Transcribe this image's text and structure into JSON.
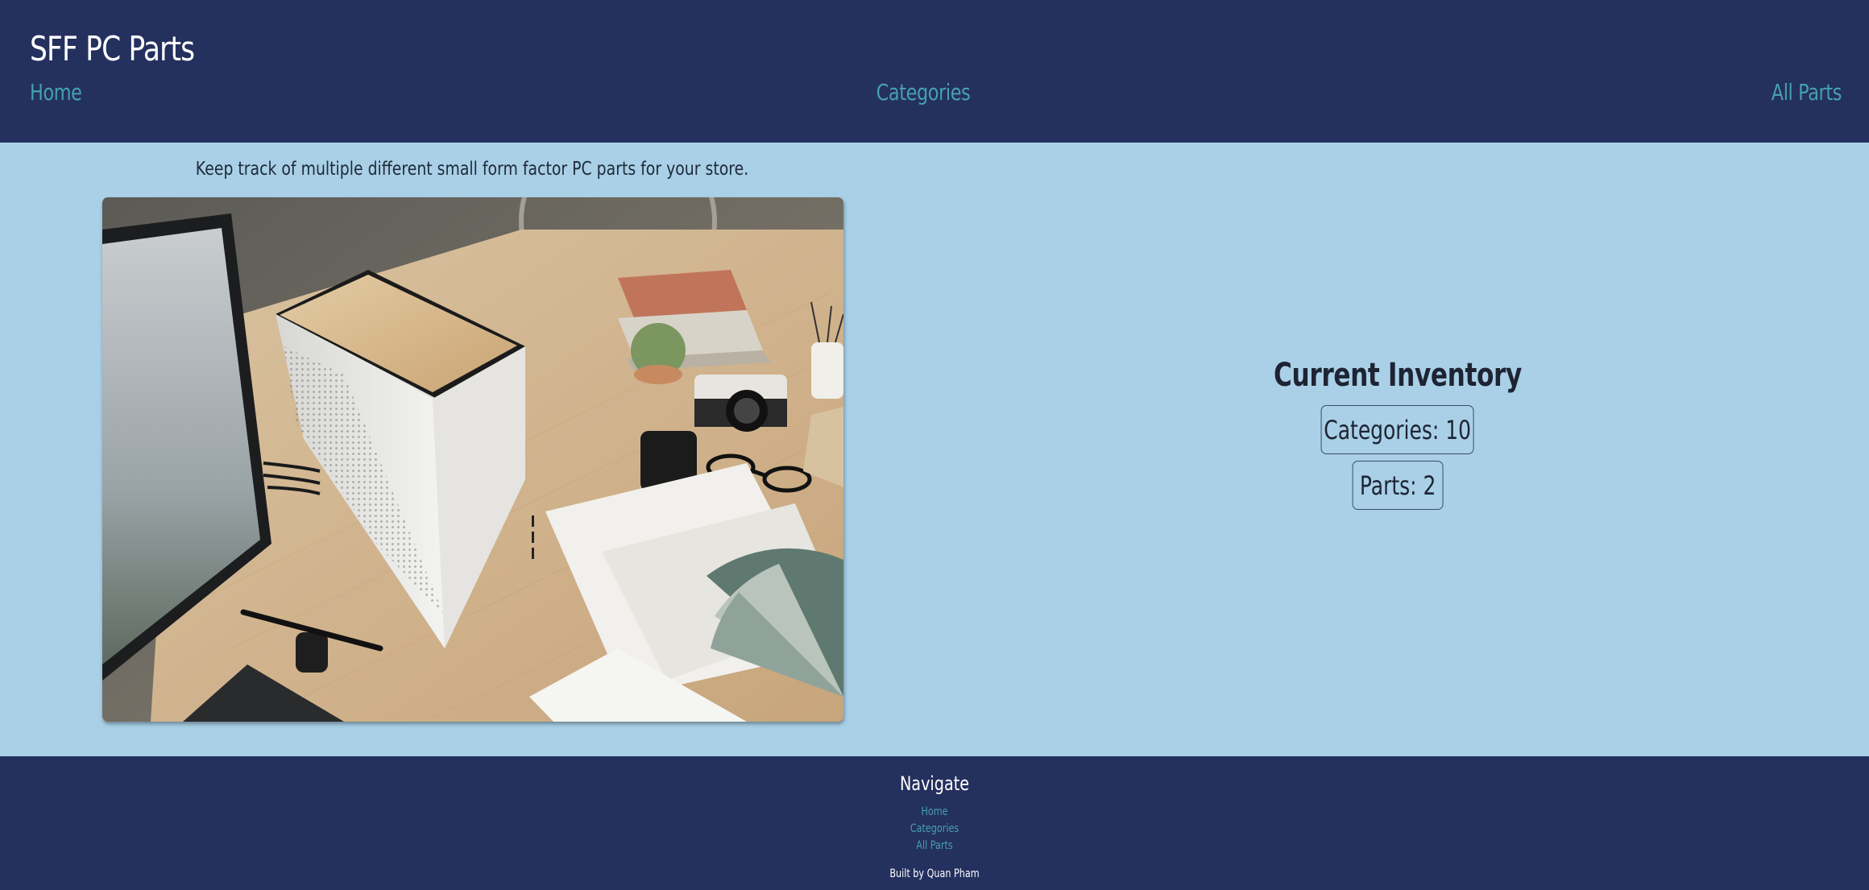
{
  "header": {
    "title": "SFF PC Parts",
    "nav": {
      "home": "Home",
      "categories": "Categories",
      "all_parts": "All Parts"
    }
  },
  "main": {
    "tagline": "Keep track of multiple different small form factor PC parts for your store.",
    "inventory": {
      "title": "Current Inventory",
      "categories_label": "Categories: 10",
      "parts_label": "Parts: 2"
    }
  },
  "footer": {
    "heading": "Navigate",
    "links": {
      "home": "Home",
      "categories": "Categories",
      "all_parts": "All Parts"
    },
    "credit": "Built by Quan Pham"
  },
  "colors": {
    "header_bg": "#24305e",
    "main_bg": "#a9d0e7",
    "link": "#46a1ad",
    "text": "#1e2433"
  }
}
